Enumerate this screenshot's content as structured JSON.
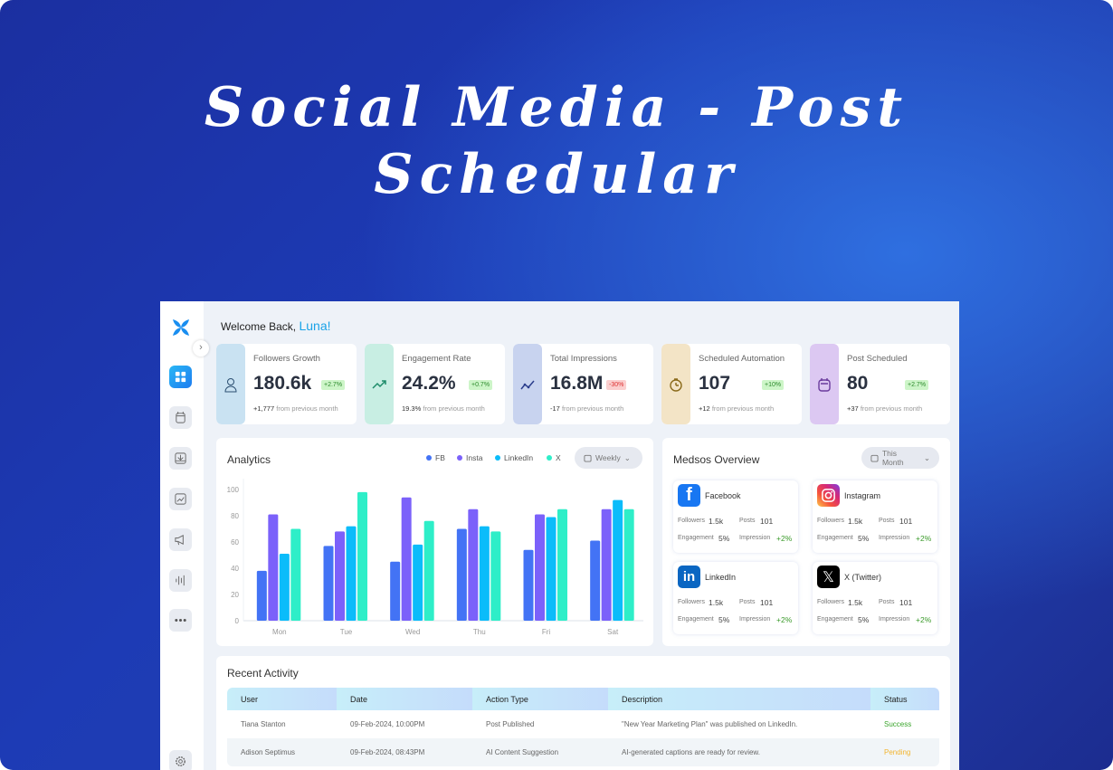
{
  "hero_title_line1": "Social Media - Post",
  "hero_title_line2": "Schedular",
  "welcome": {
    "text": "Welcome Back,",
    "name": "Luna!"
  },
  "sidebar": {
    "items": [
      "dashboard",
      "calendar",
      "inbox",
      "analytics",
      "campaigns",
      "audio",
      "more",
      "settings"
    ]
  },
  "stats": [
    {
      "label": "Followers Growth",
      "value": "180.6k",
      "badge": "+2.7%",
      "trend": "up",
      "sub_strong": "+1,777",
      "sub": "from previous month",
      "color": "#c9e2f2",
      "icon": "users-icon"
    },
    {
      "label": "Engagement Rate",
      "value": "24.2%",
      "badge": "+0.7%",
      "trend": "up",
      "sub_strong": "19.3%",
      "sub": "from previous month",
      "color": "#c8eee3",
      "icon": "trending-up-icon"
    },
    {
      "label": "Total Impressions",
      "value": "16.8M",
      "badge": "-30%",
      "trend": "down",
      "sub_strong": "-17",
      "sub": "from previous month",
      "color": "#c8d3ef",
      "icon": "line-chart-icon"
    },
    {
      "label": "Scheduled Automation",
      "value": "107",
      "badge": "+10%",
      "trend": "up",
      "sub_strong": "+12",
      "sub": "from previous month",
      "color": "#f3e4c6",
      "icon": "stopwatch-icon"
    },
    {
      "label": "Post Scheduled",
      "value": "80",
      "badge": "+2.7%",
      "trend": "up",
      "sub_strong": "+37",
      "sub": "from previous month",
      "color": "#dcc8f2",
      "icon": "calendar-icon"
    }
  ],
  "analytics": {
    "title": "Analytics",
    "period": "Weekly"
  },
  "chart_data": {
    "type": "bar",
    "categories": [
      "Mon",
      "Tue",
      "Wed",
      "Thu",
      "Fri",
      "Sat"
    ],
    "series": [
      {
        "name": "FB",
        "color": "#4373f5",
        "values": [
          38,
          57,
          45,
          70,
          54,
          61
        ]
      },
      {
        "name": "Insta",
        "color": "#7b61fa",
        "values": [
          81,
          68,
          94,
          85,
          81,
          85
        ]
      },
      {
        "name": "LinkedIn",
        "color": "#0bbcfa",
        "values": [
          51,
          72,
          58,
          72,
          79,
          92
        ]
      },
      {
        "name": "X",
        "color": "#2eeec8",
        "values": [
          70,
          98,
          76,
          68,
          85,
          85
        ]
      }
    ],
    "yticks": [
      0,
      20,
      40,
      60,
      80,
      100
    ],
    "ylim": [
      0,
      100
    ],
    "legend": "top-right",
    "grid": false
  },
  "medsos": {
    "title": "Medsos Overview",
    "period": "This Month",
    "labels": {
      "followers": "Followers",
      "posts": "Posts",
      "engagement": "Engagement",
      "impression": "Impression"
    },
    "platforms": [
      {
        "name": "Facebook",
        "followers": "1.5k",
        "posts": "101",
        "engagement": "5%",
        "impression": "+2%"
      },
      {
        "name": "Instagram",
        "followers": "1.5k",
        "posts": "101",
        "engagement": "5%",
        "impression": "+2%"
      },
      {
        "name": "LinkedIn",
        "followers": "1.5k",
        "posts": "101",
        "engagement": "5%",
        "impression": "+2%"
      },
      {
        "name": "X (Twitter)",
        "followers": "1.5k",
        "posts": "101",
        "engagement": "5%",
        "impression": "+2%"
      }
    ]
  },
  "activity": {
    "title": "Recent Activity",
    "columns": [
      "User",
      "Date",
      "Action Type",
      "Description",
      "Status"
    ],
    "rows": [
      {
        "user": "Tiana Stanton",
        "date": "09-Feb-2024, 10:00PM",
        "action": "Post Published",
        "description": "\"New Year Marketing Plan\" was published on LinkedIn.",
        "status": "Success",
        "status_color": "#3aa52c"
      },
      {
        "user": "Adison Septimus",
        "date": "09-Feb-2024, 08:43PM",
        "action": "AI Content Suggestion",
        "description": "AI-generated captions are ready for review.",
        "status": "Pending",
        "status_color": "#f2b531"
      }
    ]
  }
}
